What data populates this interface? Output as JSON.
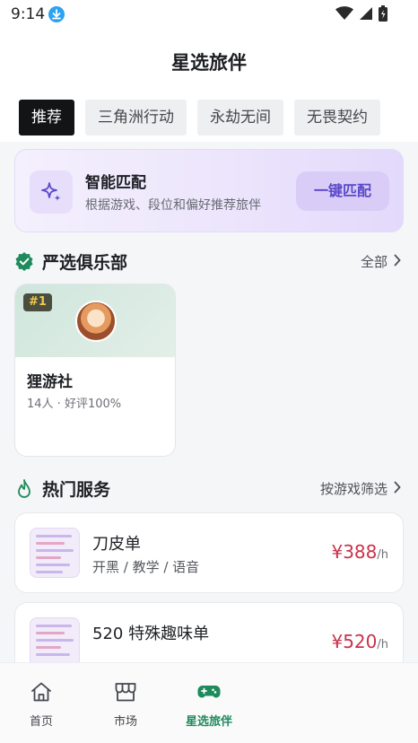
{
  "status_bar": {
    "time": "9:14"
  },
  "header": {
    "title": "星选旅伴"
  },
  "tabs": [
    {
      "label": "推荐",
      "active": true
    },
    {
      "label": "三角洲行动",
      "active": false
    },
    {
      "label": "永劫无间",
      "active": false
    },
    {
      "label": "无畏契约",
      "active": false
    }
  ],
  "banner": {
    "title": "智能匹配",
    "subtitle": "根据游戏、段位和偏好推荐旅伴",
    "button_label": "一键匹配"
  },
  "clubs_section": {
    "title": "严选俱乐部",
    "link_label": "全部"
  },
  "clubs": [
    {
      "rank": "#1",
      "name": "狸游社",
      "stats": "14人 · 好评100%"
    }
  ],
  "services_section": {
    "title": "热门服务",
    "link_label": "按游戏筛选"
  },
  "services": [
    {
      "title": "刀皮单",
      "tags": "开黑 / 教学 / 语音",
      "price": "¥388",
      "unit": "/h"
    },
    {
      "title": "520 特殊趣味单",
      "tags": "",
      "price": "¥520",
      "unit": "/h"
    }
  ],
  "bottom_nav": [
    {
      "label": "首页",
      "icon": "home-icon",
      "active": false
    },
    {
      "label": "市场",
      "icon": "store-icon",
      "active": false
    },
    {
      "label": "星选旅伴",
      "icon": "gamepad-icon",
      "active": true
    }
  ],
  "colors": {
    "accent_green": "#1f8a5c",
    "price_red": "#c9324a",
    "match_purple": "#5b49c9"
  }
}
